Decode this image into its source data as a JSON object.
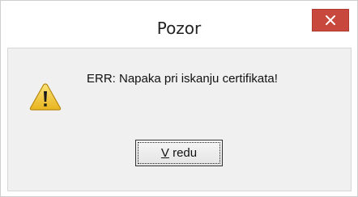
{
  "dialog": {
    "title": "Pozor",
    "message": "ERR: Napaka pri iskanju certifikata!",
    "icon": "warning-icon",
    "ok_button": {
      "mnemonic": "V",
      "rest": " redu"
    }
  },
  "colors": {
    "close_button": "#c9483d",
    "body_background": "#f0f0f0",
    "warning_yellow": "#f2c531"
  }
}
